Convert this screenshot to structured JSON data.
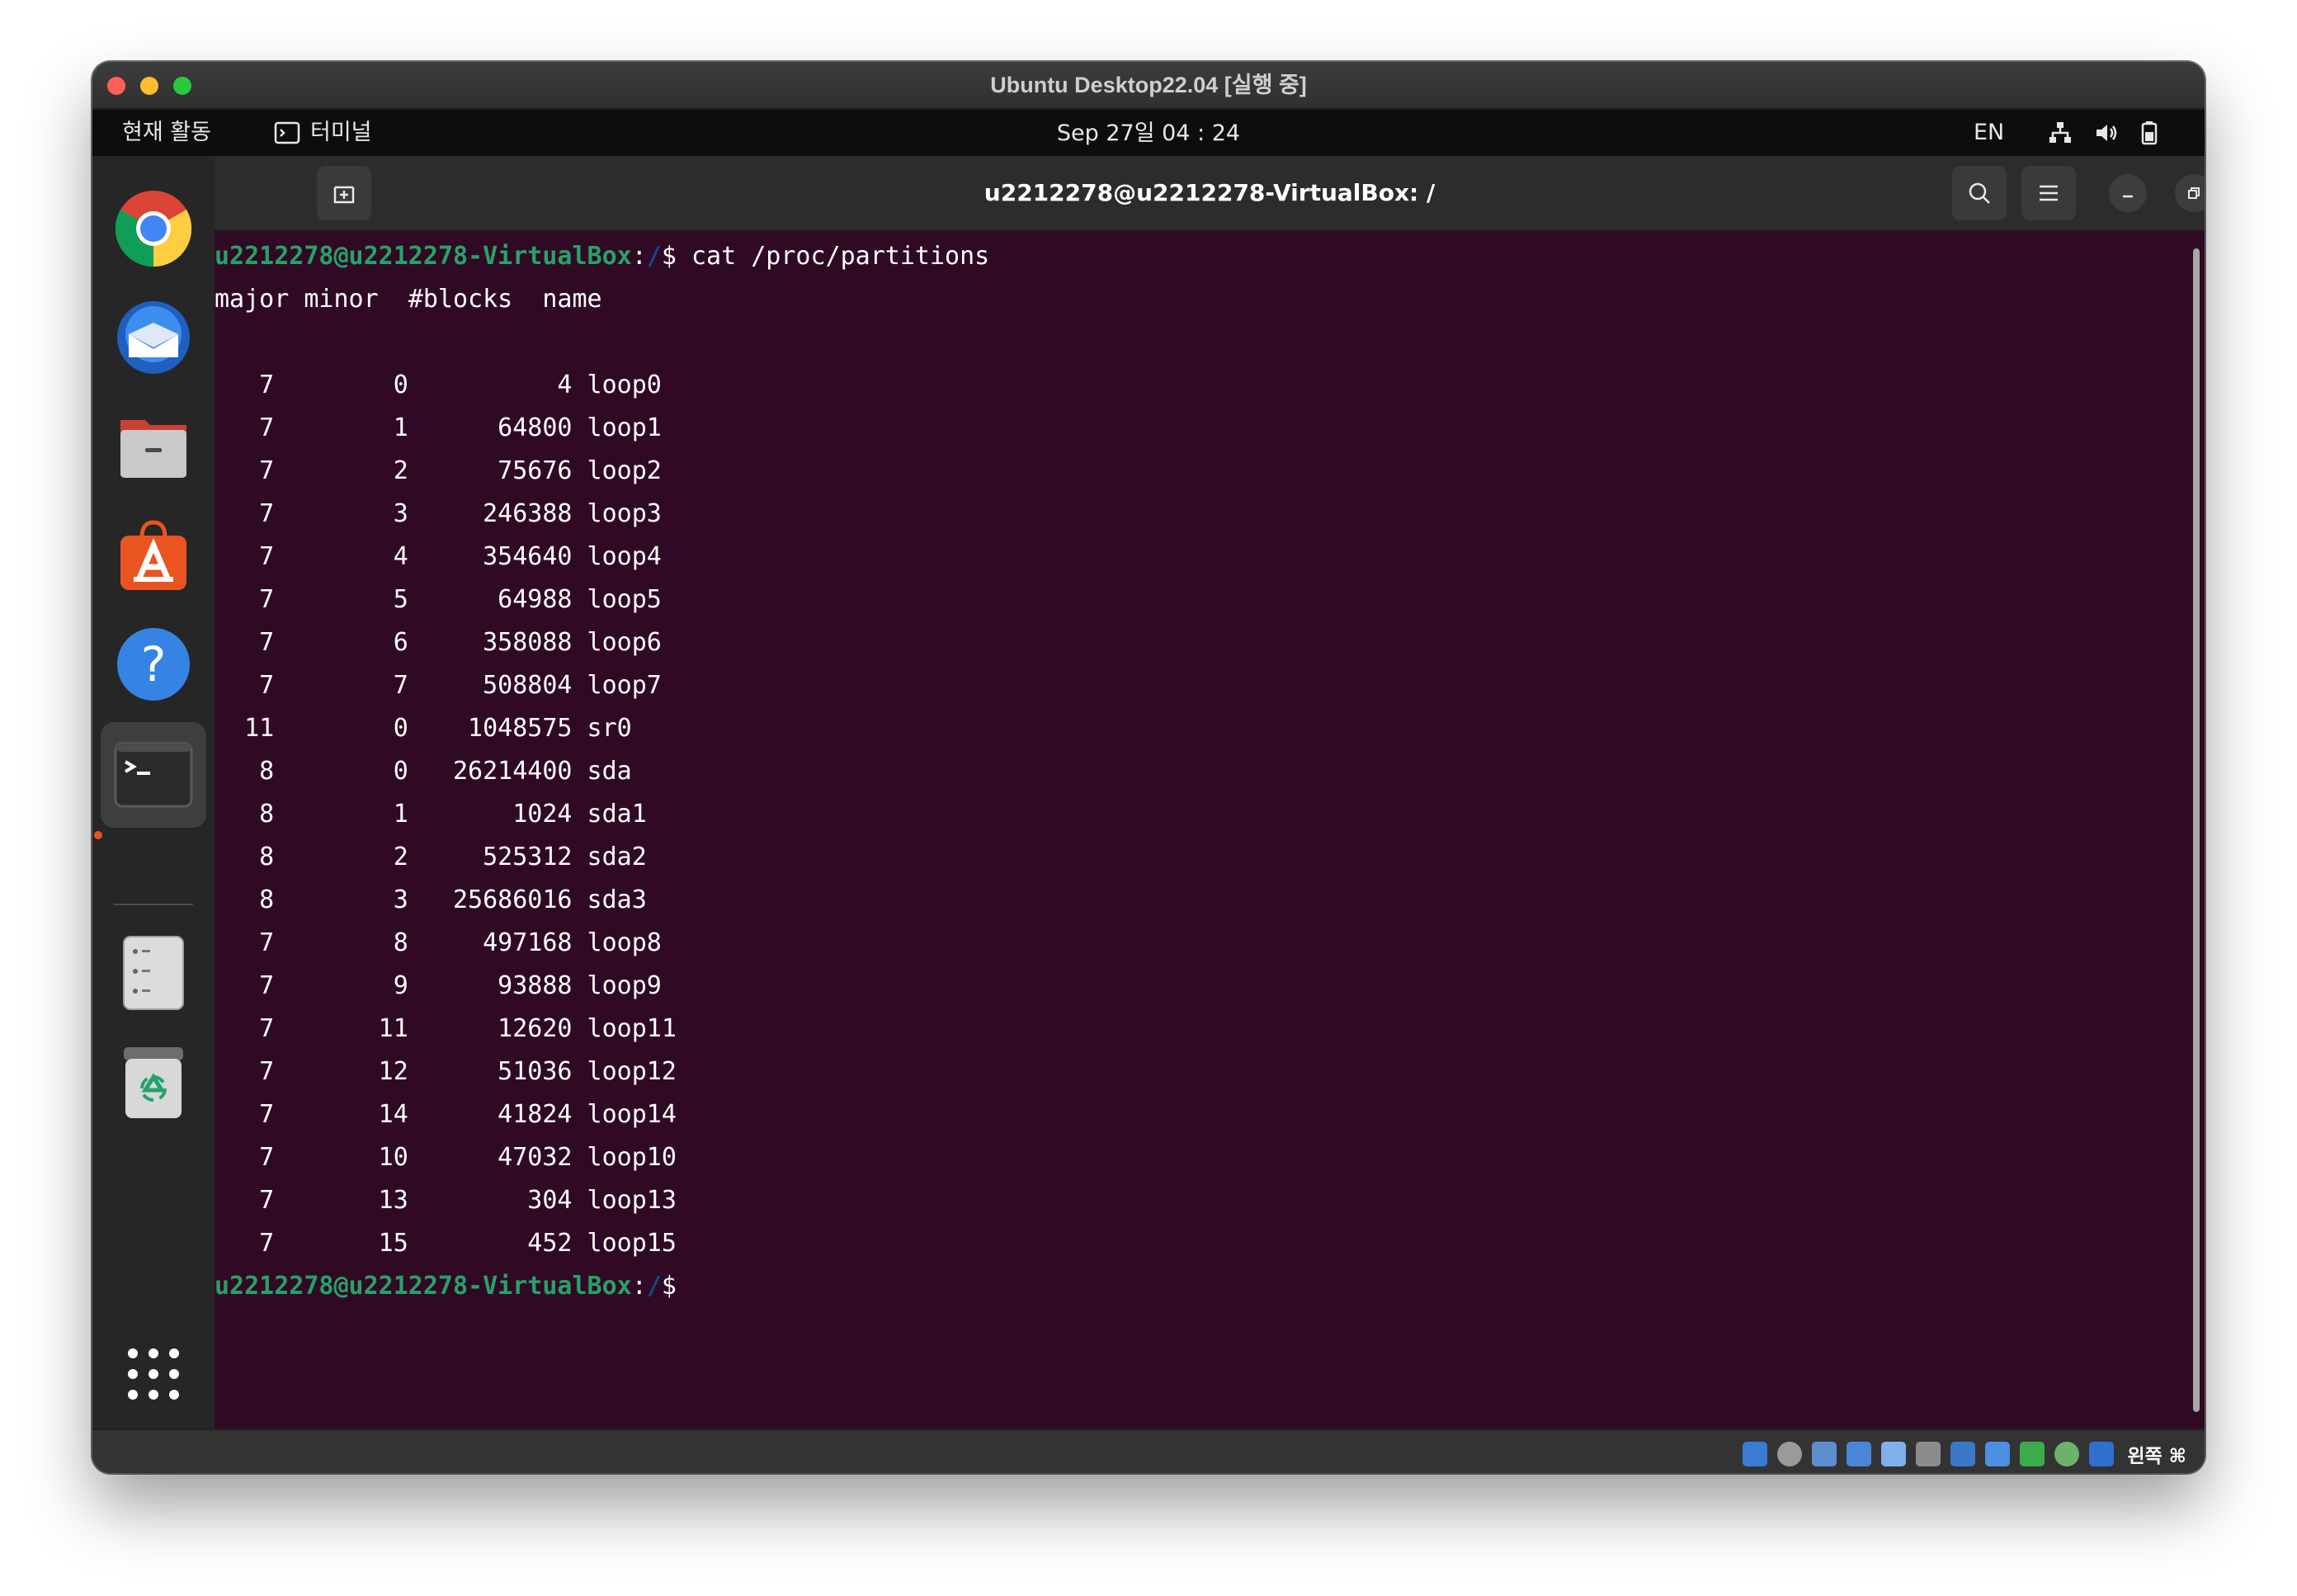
{
  "vm_window": {
    "title": "Ubuntu Desktop22.04 [실행 중]"
  },
  "topbar": {
    "activities": "현재 활동",
    "app_label": "터미널",
    "clock": "Sep 27일  04 : 24",
    "lang": "EN"
  },
  "dock": {
    "items": [
      "chrome-icon",
      "thunderbird-icon",
      "files-icon",
      "app-center-icon",
      "help-icon",
      "terminal-icon",
      "disk-icon",
      "trash-icon",
      "app-grid-icon"
    ]
  },
  "terminal": {
    "title": "u2212278@u2212278-VirtualBox: /",
    "prompt_user": "u2212278@u2212278-VirtualBox",
    "prompt_colon": ":",
    "prompt_path": "/",
    "prompt_symbol": "$",
    "command": " cat /proc/partitions",
    "header": "major minor  #blocks  name",
    "rows": [
      "   7        0          4 loop0",
      "   7        1      64800 loop1",
      "   7        2      75676 loop2",
      "   7        3     246388 loop3",
      "   7        4     354640 loop4",
      "   7        5      64988 loop5",
      "   7        6     358088 loop6",
      "   7        7     508804 loop7",
      "  11        0    1048575 sr0",
      "   8        0   26214400 sda",
      "   8        1       1024 sda1",
      "   8        2     525312 sda2",
      "   8        3   25686016 sda3",
      "   7        8     497168 loop8",
      "   7        9      93888 loop9",
      "   7       11      12620 loop11",
      "   7       12      51036 loop12",
      "   7       14      41824 loop14",
      "   7       10      47032 loop10",
      "   7       13        304 loop13",
      "   7       15        452 loop15"
    ]
  },
  "status_bar": {
    "host_key": "왼쪽 ⌘"
  },
  "colors": {
    "terminal_bg": "#300a24",
    "prompt_user": "#26a269",
    "prompt_path": "#12488b",
    "accent": "#e95420"
  }
}
